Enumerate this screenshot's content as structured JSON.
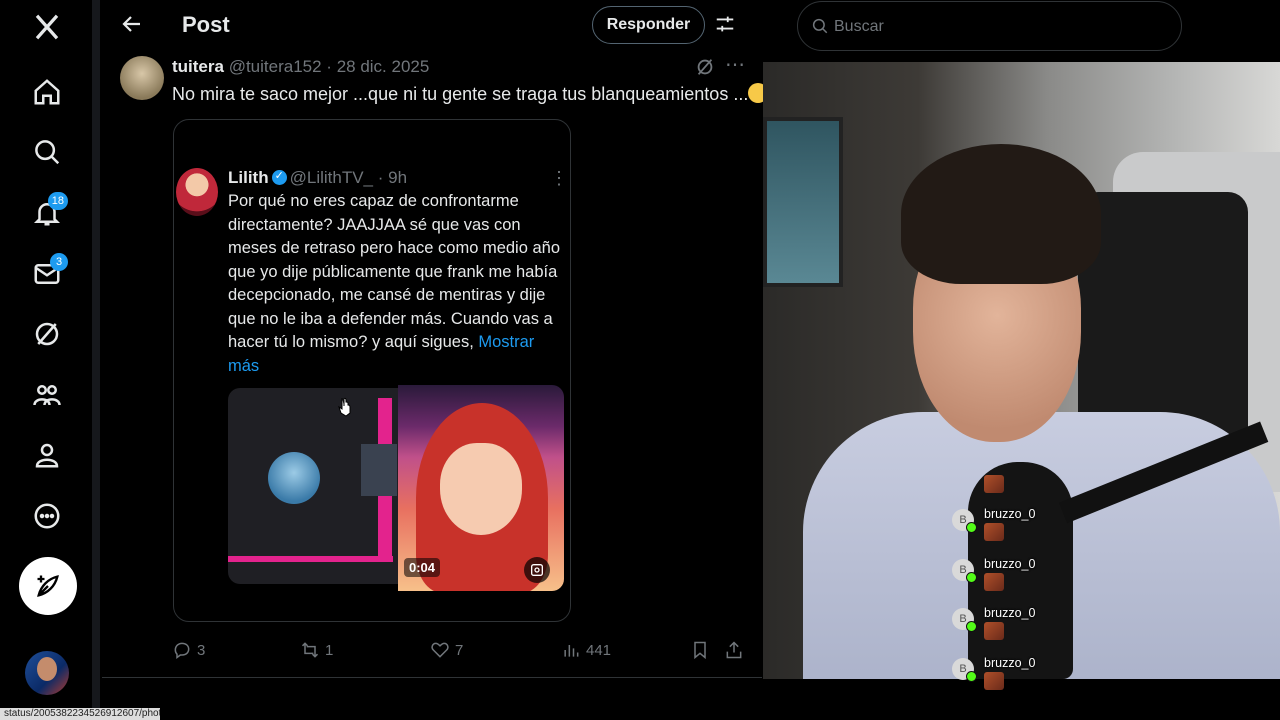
{
  "nav": {
    "items": [
      {
        "name": "x-logo-icon"
      },
      {
        "name": "home-icon"
      },
      {
        "name": "search-icon"
      },
      {
        "name": "notifications-icon",
        "badge": "18"
      },
      {
        "name": "messages-icon",
        "badge": "3"
      },
      {
        "name": "grok-icon"
      },
      {
        "name": "communities-icon"
      },
      {
        "name": "profile-icon"
      },
      {
        "name": "more-icon"
      }
    ],
    "post_button_icon": "compose-icon"
  },
  "header": {
    "title": "Post",
    "reply_label": "Responder"
  },
  "tweet": {
    "name": "tuitera",
    "handle": "@tuitera152",
    "separator": " · ",
    "date": "28 dic. 2025",
    "text": "No mira te saco mejor ...que ni tu gente se traga tus blanqueamientos ...",
    "emoji": "winking-face"
  },
  "quote": {
    "name": "Lilith",
    "handle": "@LilithTV_",
    "time": "9h",
    "text": "Por qué no eres capaz de confrontarme directamente? JAAJJAA sé que vas con meses de retraso pero hace como medio año que yo dije públicamente que frank me había decepcionado, me cansé de mentiras y dije que no le iba a defender más. Cuando vas a hacer tú lo mismo? y aquí sigues, ",
    "show_more": "Mostrar más",
    "video_time": "0:04"
  },
  "actions": {
    "replies": "3",
    "reposts": "1",
    "likes": "7",
    "views": "441"
  },
  "search": {
    "placeholder": "Buscar"
  },
  "chat": [
    {
      "user": "bruzzo_0",
      "badge": "B"
    },
    {
      "user": "bruzzo_0",
      "badge": "B"
    },
    {
      "user": "bruzzo_0",
      "badge": "B"
    },
    {
      "user": "bruzzo_0",
      "badge": "B"
    }
  ],
  "status_bar": {
    "url": "status/2005382234526912607/photo/1"
  },
  "colors": {
    "accent": "#1d9bf0",
    "background": "#000000",
    "muted": "#71767b",
    "border": "#2f3336"
  }
}
